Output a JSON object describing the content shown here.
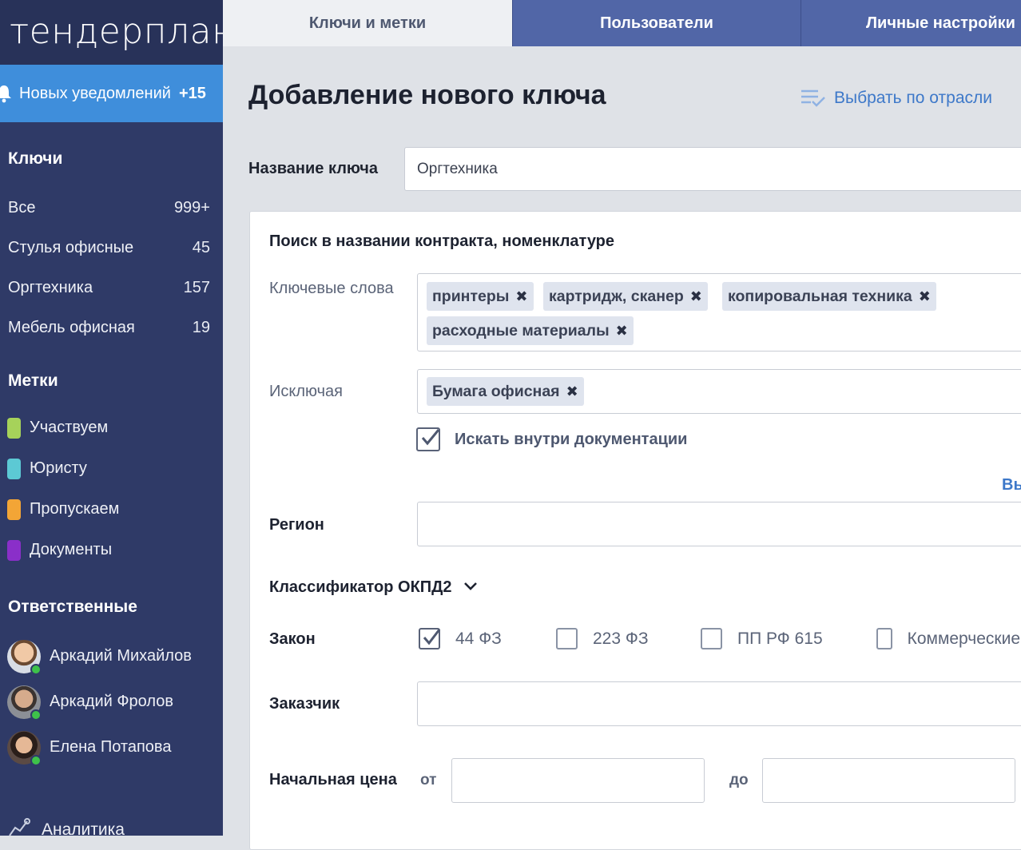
{
  "brand": {
    "logo_text": "тендерплан"
  },
  "notifications": {
    "label": "Новых уведомлений",
    "count": "+15"
  },
  "sidebar": {
    "keys_title": "Ключи",
    "keys": [
      {
        "label": "Все",
        "count": "999+"
      },
      {
        "label": "Стулья офисные",
        "count": "45"
      },
      {
        "label": "Оргтехника",
        "count": "157"
      },
      {
        "label": "Мебель офисная",
        "count": "19"
      }
    ],
    "tags_title": "Метки",
    "tags": [
      {
        "label": "Участвуем",
        "color": "#a6d25a"
      },
      {
        "label": "Юристу",
        "color": "#5cc9d4"
      },
      {
        "label": "Пропускаем",
        "color": "#f3a536"
      },
      {
        "label": "Документы",
        "color": "#8a2fc9"
      }
    ],
    "responsible_title": "Ответственные",
    "people": [
      {
        "name": "Аркадий Михайлов"
      },
      {
        "name": "Аркадий Фролов"
      },
      {
        "name": "Елена Потапова"
      }
    ],
    "analytics_label": "Аналитика"
  },
  "tabs": [
    {
      "label": "Ключи и метки",
      "active": true
    },
    {
      "label": "Пользователи",
      "active": false
    },
    {
      "label": "Личные настройки",
      "active": false
    }
  ],
  "main": {
    "title": "Добавление нового ключа",
    "by_industry": "Выбрать по отрасли",
    "name_label": "Название ключа",
    "name_value": "Оргтехника",
    "search_section_title": "Поиск в названии контракта, номенклатуре",
    "keywords_label": "Ключевые слова",
    "keywords": [
      "принтеры",
      "картридж, сканер",
      "копировальная техника",
      "расходные материалы"
    ],
    "exclude_label": "Исключая",
    "exclude": [
      "Бумага офисная"
    ],
    "search_docs_label": "Искать внутри документации",
    "cut_link": "Вь",
    "region_label": "Регион",
    "classifier_label": "Классификатор ОКПД2",
    "law_label": "Закон",
    "laws": [
      {
        "label": "44 ФЗ",
        "checked": true
      },
      {
        "label": "223 ФЗ",
        "checked": false
      },
      {
        "label": "ПП РФ 615",
        "checked": false
      },
      {
        "label": "Коммерческие",
        "checked": false
      }
    ],
    "customer_label": "Заказчик",
    "price_label": "Начальная цена",
    "price_from": "от",
    "price_to": "до"
  },
  "colors": {
    "sidebar_bg": "#2f3a67",
    "notif_bg": "#3f8edb",
    "tab_bg": "#5166a7",
    "link": "#3d78c9"
  }
}
